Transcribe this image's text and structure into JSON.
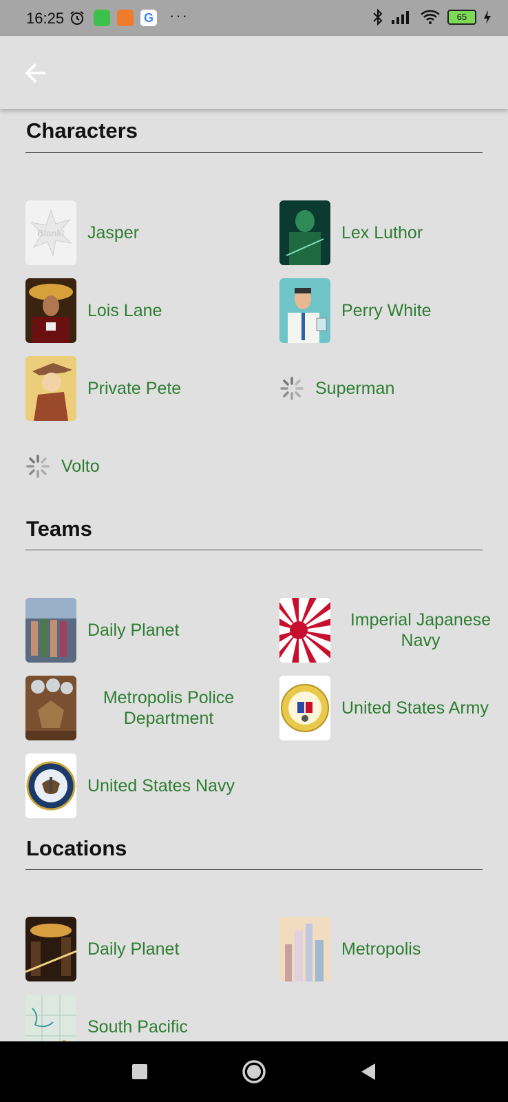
{
  "status_bar": {
    "time": "16:25",
    "battery": "65",
    "colors": {
      "background": "#a6a6a6"
    },
    "icons": [
      "alarm-icon",
      "app-green-icon",
      "app-orange-icon",
      "google-icon",
      "more-dots-icon",
      "bluetooth-icon",
      "signal-icon",
      "wifi-icon",
      "battery-icon",
      "charging-icon"
    ],
    "more": "···"
  },
  "app_bar": {
    "back_icon": "arrow-left-icon"
  },
  "theme": {
    "link_color": "#2e7d32",
    "background": "#e0e0e0"
  },
  "sections": {
    "characters": {
      "title": "Characters",
      "items": [
        {
          "label": "Jasper"
        },
        {
          "label": "Lex Luthor"
        },
        {
          "label": "Lois Lane"
        },
        {
          "label": "Perry White"
        },
        {
          "label": "Private Pete"
        },
        {
          "label": "Superman"
        },
        {
          "label": "Volto"
        }
      ]
    },
    "teams": {
      "title": "Teams",
      "items": [
        {
          "label": "Daily Planet"
        },
        {
          "label": "Imperial Japanese Navy"
        },
        {
          "label": "Metropolis Police Department"
        },
        {
          "label": "United States Army"
        },
        {
          "label": "United States Navy"
        }
      ]
    },
    "locations": {
      "title": "Locations",
      "items": [
        {
          "label": "Daily Planet"
        },
        {
          "label": "Metropolis"
        },
        {
          "label": "South Pacific"
        }
      ]
    }
  },
  "nav_bar": {
    "icons": [
      "recents-square-icon",
      "home-circle-icon",
      "back-triangle-icon"
    ]
  }
}
